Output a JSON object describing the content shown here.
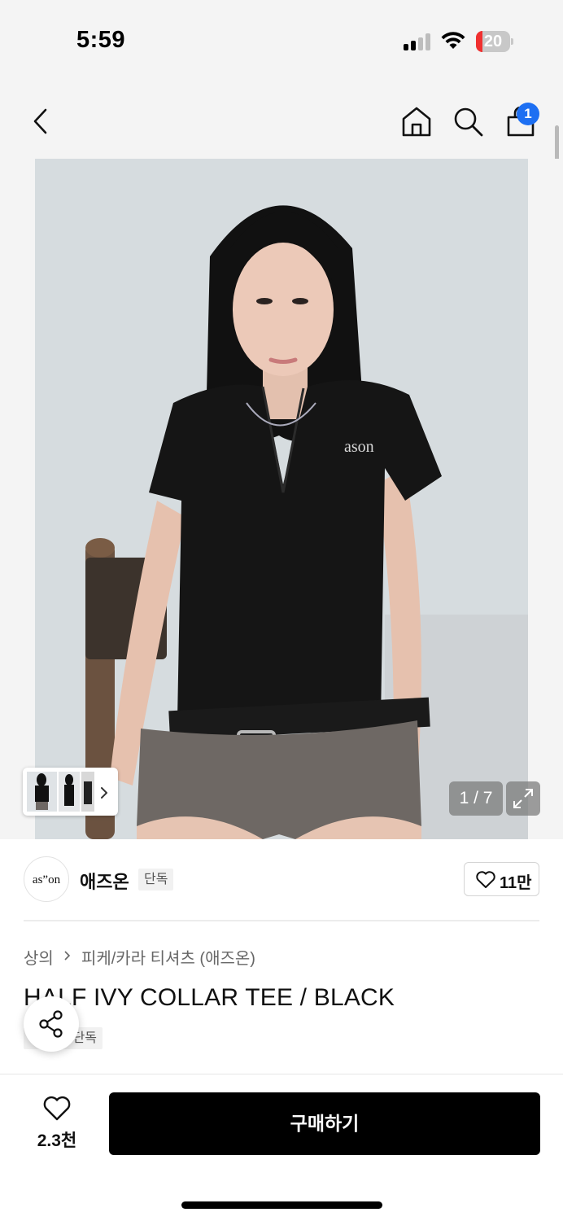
{
  "status_bar": {
    "time": "5:59",
    "battery_level": "20",
    "battery_fraction": 0.2,
    "battery_color": "#f0302f"
  },
  "nav": {
    "back_icon": "chevron-left-icon",
    "home_icon": "home-icon",
    "search_icon": "search-icon",
    "cart_icon": "shopping-bag-icon",
    "cart_count": "1",
    "badge_color": "#1d6ff2"
  },
  "gallery": {
    "image_description": "product-photo",
    "image_counter": "1 / 7",
    "expand_icon": "expand-icon",
    "thumbnails_icon": "chevron-right-icon"
  },
  "brand": {
    "logo_text": "as”on",
    "name": "애즈온",
    "badge": "단독",
    "like_icon": "heart-icon",
    "likes": "11만"
  },
  "breadcrumb": {
    "category": "상의",
    "subcategory": "피케/카라 티셔츠 (애즈온)"
  },
  "product": {
    "title": "HALF IVY COLLAR TEE / BLACK",
    "badge": "단독"
  },
  "share": {
    "icon": "share-icon"
  },
  "bottom_bar": {
    "wish_icon": "heart-icon",
    "wish_count": "2.3천",
    "buy_label": "구매하기"
  }
}
